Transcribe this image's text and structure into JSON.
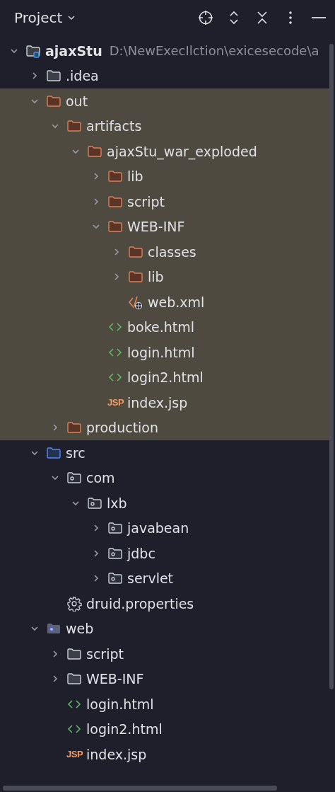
{
  "panel": {
    "title": "Project"
  },
  "tree": [
    {
      "kind": "module",
      "label": "ajaxStu",
      "path": "D:\\NewExecIlction\\exicesecode\\a",
      "expanded": true,
      "children": [
        {
          "kind": "folder",
          "label": ".idea",
          "expanded": false
        },
        {
          "kind": "excluded",
          "label": "out",
          "expanded": true,
          "excluded": true,
          "children": [
            {
              "kind": "excluded",
              "label": "artifacts",
              "expanded": true,
              "children": [
                {
                  "kind": "excluded",
                  "label": "ajaxStu_war_exploded",
                  "expanded": true,
                  "children": [
                    {
                      "kind": "excluded",
                      "label": "lib",
                      "expanded": false
                    },
                    {
                      "kind": "excluded",
                      "label": "script",
                      "expanded": false
                    },
                    {
                      "kind": "excluded",
                      "label": "WEB-INF",
                      "expanded": true,
                      "children": [
                        {
                          "kind": "excluded",
                          "label": "classes",
                          "expanded": false
                        },
                        {
                          "kind": "excluded",
                          "label": "lib",
                          "expanded": false
                        },
                        {
                          "kind": "xml",
                          "label": "web.xml"
                        }
                      ]
                    },
                    {
                      "kind": "html",
                      "label": "boke.html"
                    },
                    {
                      "kind": "html",
                      "label": "login.html"
                    },
                    {
                      "kind": "html",
                      "label": "login2.html"
                    },
                    {
                      "kind": "jsp",
                      "badge": "JSP",
                      "label": "index.jsp"
                    }
                  ]
                }
              ]
            },
            {
              "kind": "excluded",
              "label": "production",
              "expanded": false
            }
          ]
        },
        {
          "kind": "source",
          "label": "src",
          "expanded": true,
          "children": [
            {
              "kind": "package",
              "label": "com",
              "expanded": true,
              "children": [
                {
                  "kind": "package",
                  "label": "lxb",
                  "expanded": true,
                  "children": [
                    {
                      "kind": "package",
                      "label": "javabean",
                      "expanded": false
                    },
                    {
                      "kind": "package",
                      "label": "jdbc",
                      "expanded": false
                    },
                    {
                      "kind": "package",
                      "label": "servlet",
                      "expanded": false
                    }
                  ]
                }
              ]
            },
            {
              "kind": "properties",
              "label": "druid.properties"
            }
          ]
        },
        {
          "kind": "web",
          "label": "web",
          "expanded": true,
          "children": [
            {
              "kind": "folder",
              "label": "script",
              "expanded": false
            },
            {
              "kind": "folder",
              "label": "WEB-INF",
              "expanded": false
            },
            {
              "kind": "html",
              "label": "login.html"
            },
            {
              "kind": "html",
              "label": "login2.html"
            },
            {
              "kind": "jsp",
              "badge": "JSP",
              "label": "index.jsp"
            }
          ]
        }
      ]
    }
  ]
}
